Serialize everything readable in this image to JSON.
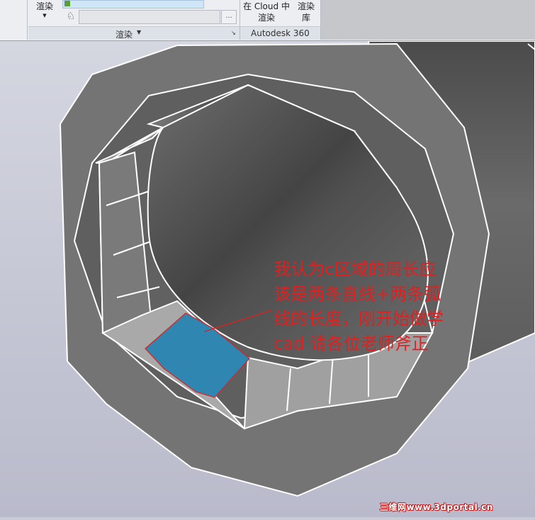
{
  "ribbon": {
    "render_button_label": "渲染",
    "render_panel_label": "渲染",
    "cloud_render_line1": "在 Cloud 中",
    "cloud_render_line2": "渲染",
    "render_gallery_line1": "渲染",
    "render_gallery_line2": "库",
    "autodesk360_label": "Autodesk 360",
    "more_button_label": "..."
  },
  "annotation": {
    "lines": [
      "我认为c区域的周长应",
      "该是两条直线+两条弧",
      "线的长度，刚开始做学",
      "cad 请各位老师斧正"
    ],
    "color": "#e02020"
  },
  "watermark": "三维网www.3dportal.cn",
  "colors": {
    "region_fill": "#2f86b0",
    "region_outline": "#e02020",
    "viewport_bg": "#c9cbd6"
  }
}
